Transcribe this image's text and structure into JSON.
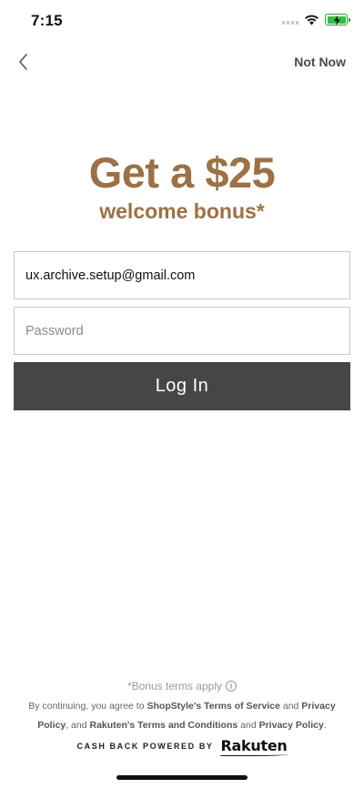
{
  "status_bar": {
    "time": "7:15",
    "icons": [
      "cellular-signal-icon",
      "wifi-icon",
      "battery-charging-icon"
    ],
    "battery_color": "#2fbf45"
  },
  "nav": {
    "back_icon": "chevron-left-icon",
    "not_now_label": "Not Now"
  },
  "hero": {
    "title": "Get a $25",
    "subtitle": "welcome bonus*",
    "accent_color": "#9c7145"
  },
  "form": {
    "email_value": "ux.archive.setup@gmail.com",
    "password_placeholder": "Password",
    "login_label": "Log In",
    "button_color": "#464646"
  },
  "footer": {
    "bonus_terms": "*Bonus terms apply",
    "info_icon": "info-icon",
    "legal_prefix": "By continuing, you agree to ",
    "legal_terms": "ShopStyle's Terms of Service",
    "legal_and1": " and ",
    "legal_privacy1": "Privacy Policy",
    "legal_mid": ", and ",
    "legal_rakuten_terms": "Rakuten's Terms and Conditions",
    "legal_and2": " and ",
    "legal_privacy2": "Privacy Policy",
    "legal_suffix": ".",
    "cashback_label": "CASH BACK POWERED BY",
    "rakuten_logo": "Rakuten"
  }
}
